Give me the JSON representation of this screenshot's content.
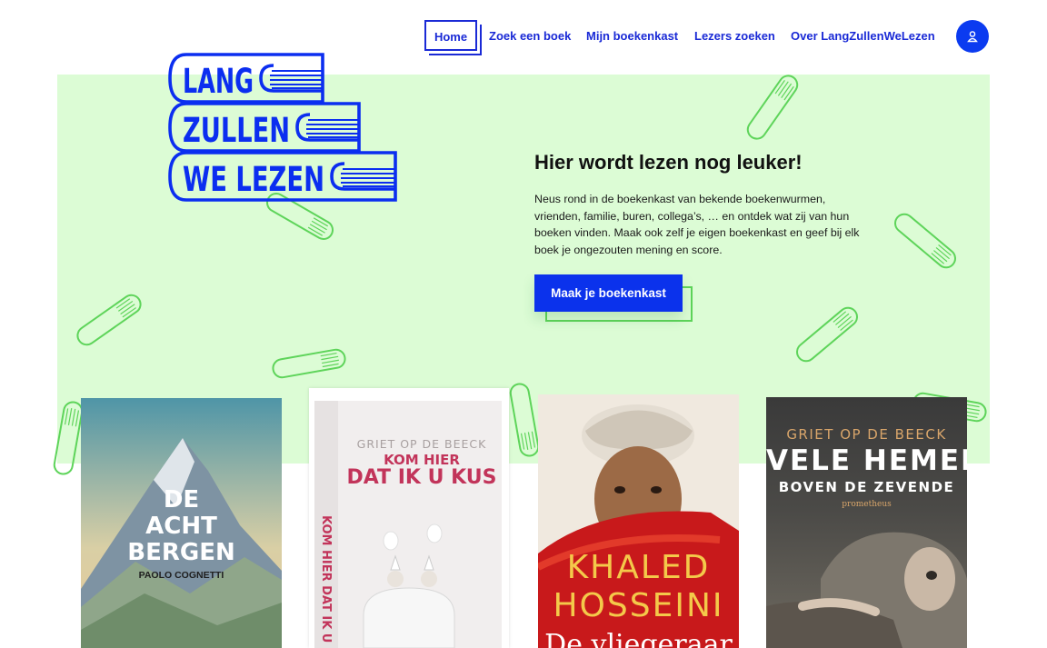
{
  "nav": {
    "home": "Home",
    "search": "Zoek een boek",
    "shelf": "Mijn boekenkast",
    "readers": "Lezers zoeken",
    "about": "Over LangZullenWeLezen"
  },
  "logo": {
    "line1": "LANG",
    "line2": "ZULLEN",
    "line3": "WE LEZEN"
  },
  "hero": {
    "title": "Hier wordt lezen nog leuker!",
    "text": "Neus rond in de boekenkast van bekende boekenwurmen, vrienden, familie, buren, collega’s, … en ontdek wat zij van hun boeken vinden. Maak ook zelf je eigen boekenkast en geef bij elk boek je ongezouten mening en score.",
    "cta": "Maak je boekenkast"
  },
  "books": [
    {
      "title_l1": "DE",
      "title_l2": "ACHT",
      "title_l3": "BERGEN",
      "author": "PAOLO COGNETTI"
    },
    {
      "author": "GRIET OP DE BEECK",
      "title_l1": "KOM HIER",
      "title_l2": "DAT IK U KUS",
      "spine": "KOM HIER DAT IK U KUS"
    },
    {
      "author_l1": "KHALED",
      "author_l2": "HOSSEINI",
      "title": "De vliegeraar"
    },
    {
      "author": "GRIET OP DE BEECK",
      "title_l1": "VELE HEMELS",
      "title_l2": "BOVEN DE ZEVENDE",
      "publisher": "prometheus"
    }
  ],
  "icons": {
    "user": "user-icon"
  },
  "colors": {
    "brand_blue": "#1a2ad6",
    "hero_green": "#dcfcd5",
    "deco_green": "#5ed45a"
  }
}
